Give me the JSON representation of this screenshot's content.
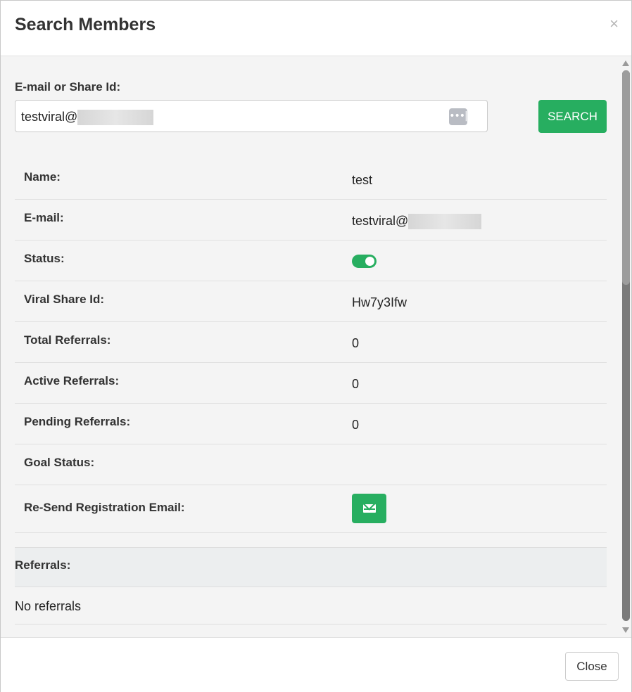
{
  "modal": {
    "title": "Search Members",
    "close_icon": "×"
  },
  "search": {
    "label": "E-mail or Share Id:",
    "value": "testviral@",
    "button_label": "SEARCH",
    "password_manager_icon": "•••|"
  },
  "member": {
    "rows": [
      {
        "label": "Name:",
        "value": "test"
      },
      {
        "label": "E-mail:",
        "value": "testviral@"
      },
      {
        "label": "Status:",
        "value": ""
      },
      {
        "label": "Viral Share Id:",
        "value": "Hw7y3Ifw"
      },
      {
        "label": "Total Referrals:",
        "value": "0"
      },
      {
        "label": "Active Referrals:",
        "value": "0"
      },
      {
        "label": "Pending Referrals:",
        "value": "0"
      },
      {
        "label": "Goal Status:",
        "value": ""
      },
      {
        "label": "Re-Send Registration Email:",
        "value": ""
      }
    ],
    "status_enabled": true,
    "accent_color": "#27ae60"
  },
  "referrals": {
    "header": "Referrals:",
    "empty_text": "No referrals"
  },
  "footer": {
    "close_label": "Close"
  }
}
